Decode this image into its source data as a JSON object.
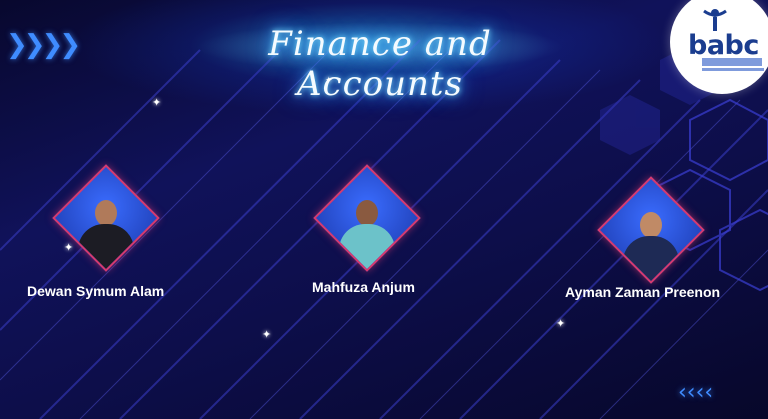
{
  "title": "Finance and Accounts",
  "logo": {
    "text": "babc",
    "icon": "person-arms-raised-icon"
  },
  "members": [
    {
      "name": "Dewan Symum Alam",
      "shirt_color": "#1c1c24"
    },
    {
      "name": "Mahfuza Anjum",
      "shirt_color": "#6cc2c9"
    },
    {
      "name": "Ayman Zaman Preenon",
      "shirt_color": "#1e2a55"
    }
  ],
  "colors": {
    "background": "#0b0b3a",
    "accent_glow": "#3fb8ff",
    "frame_border": "#d7396d",
    "chevron": "#3f8cff"
  },
  "decorations": {
    "left_chevrons_icon": "double-chevron-right-icon",
    "right_chevrons_icon": "chevron-left-icon",
    "sparkle_icon": "sparkle-icon"
  }
}
